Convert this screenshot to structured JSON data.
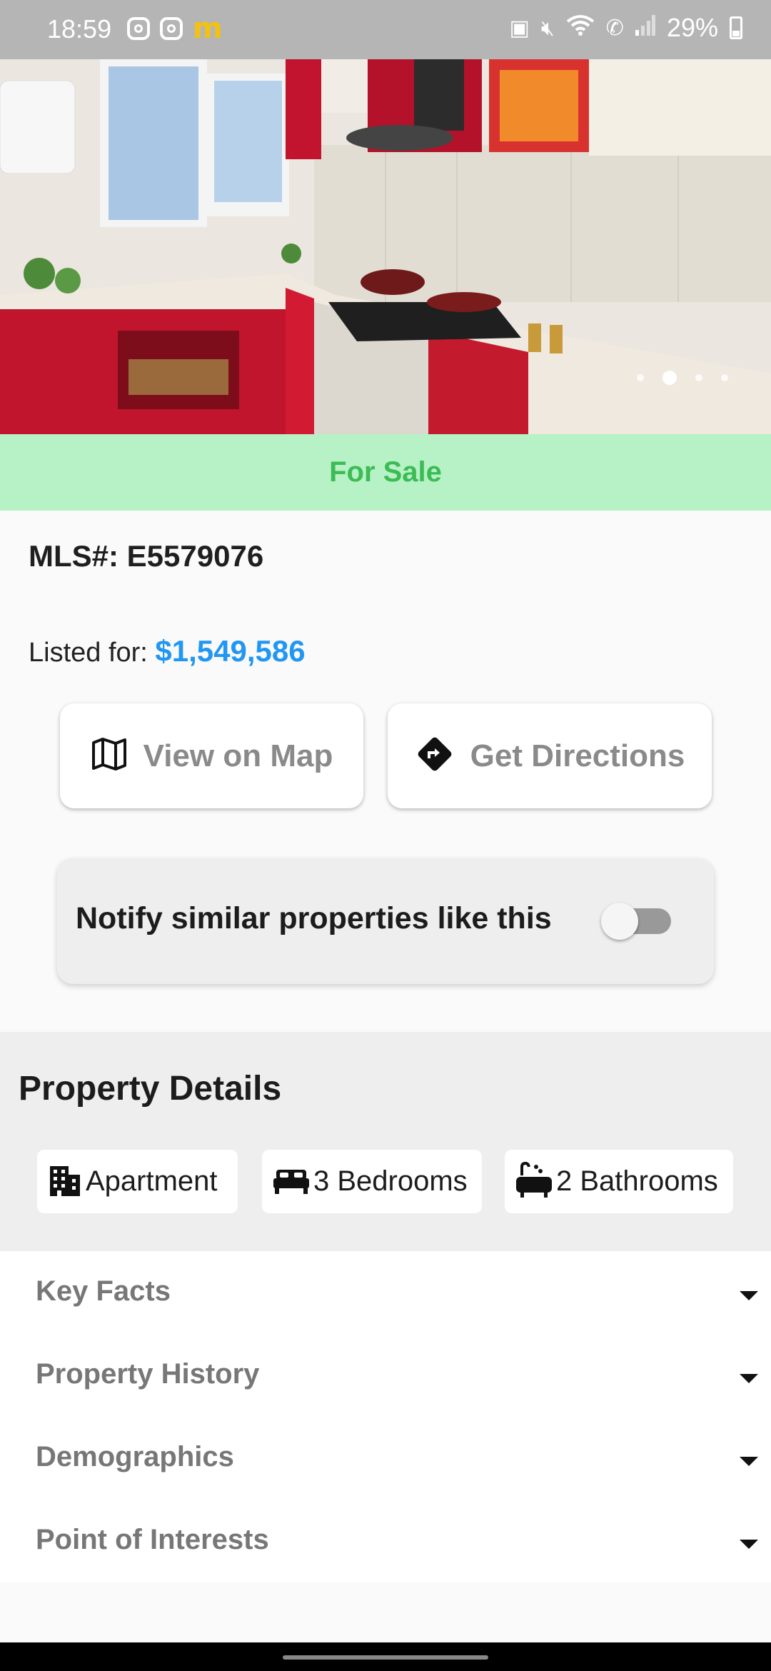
{
  "status_bar": {
    "time": "18:59",
    "left_icons": [
      "instagram-icon",
      "instagram-icon",
      "mcdonalds-icon"
    ],
    "right_icons": [
      "battery-saver-icon",
      "mute-icon",
      "wifi-icon",
      "wifi-calling-icon",
      "signal-icon"
    ],
    "battery": "29%"
  },
  "gallery": {
    "slide_count": 4,
    "active_index": 1
  },
  "banner": {
    "label": "For Sale",
    "color": "#3dbb55",
    "background": "#b6f2c5"
  },
  "listing": {
    "mls": "MLS#: E5579076",
    "listed_label": "Listed for: ",
    "price": "$1,549,586",
    "price_color": "#2196f3"
  },
  "actions": {
    "view_map": "View on Map",
    "get_directions": "Get Directions"
  },
  "notify": {
    "label": "Notify similar properties like this",
    "enabled": false
  },
  "details": {
    "title": "Property Details",
    "chips": [
      {
        "icon": "building-icon",
        "label": "Apartment"
      },
      {
        "icon": "bed-icon",
        "label": "3 Bedrooms"
      },
      {
        "icon": "bathtub-icon",
        "label": "2 Bathrooms"
      }
    ]
  },
  "sections": [
    {
      "label": "Key Facts"
    },
    {
      "label": "Property History"
    },
    {
      "label": "Demographics"
    },
    {
      "label": "Point of Interests"
    }
  ]
}
